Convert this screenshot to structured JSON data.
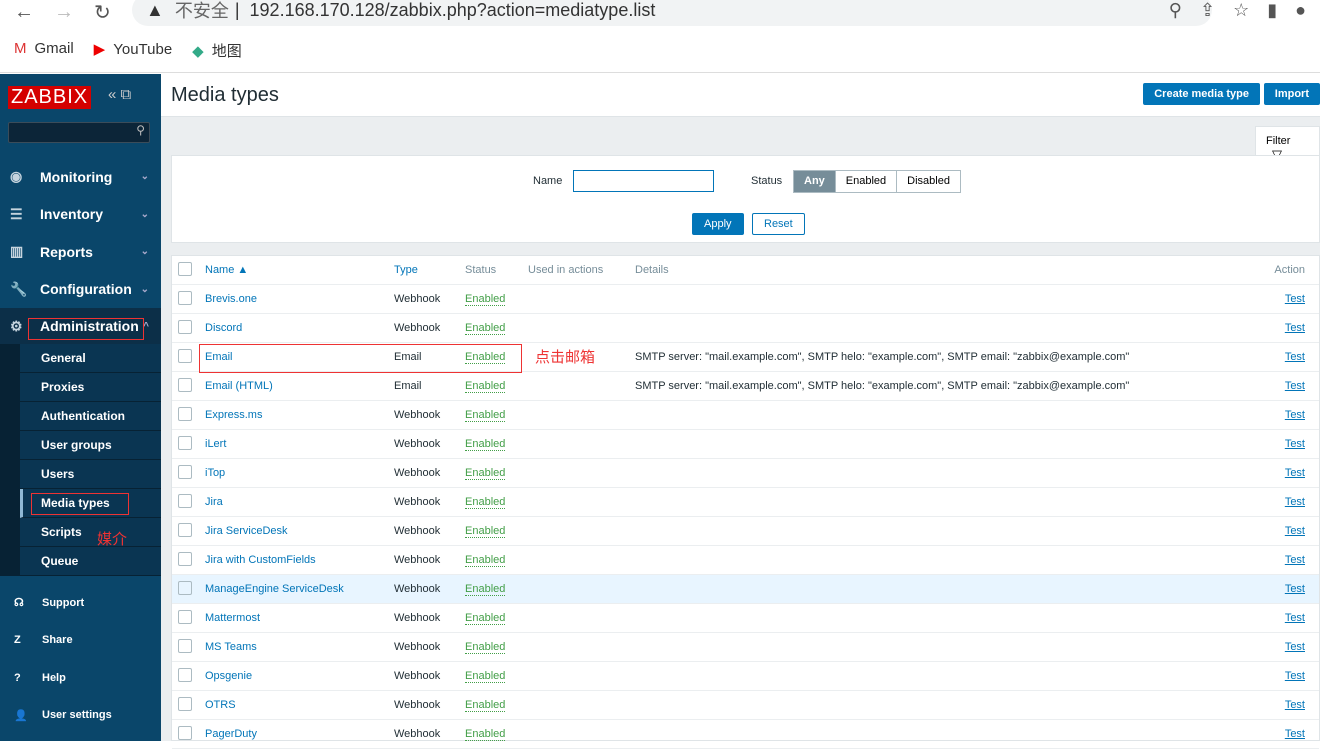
{
  "browser": {
    "insecure": "不安全",
    "url": "192.168.170.128/zabbix.php?action=mediatype.list",
    "bookmarks": [
      "Gmail",
      "YouTube",
      "地图"
    ]
  },
  "sidebar": {
    "logo": "ZABBIX",
    "menu": [
      {
        "label": "Monitoring",
        "icon": "eye-icon"
      },
      {
        "label": "Inventory",
        "icon": "list-icon"
      },
      {
        "label": "Reports",
        "icon": "chart-icon"
      },
      {
        "label": "Configuration",
        "icon": "wrench-icon"
      }
    ],
    "admin": "Administration",
    "sub": [
      "General",
      "Proxies",
      "Authentication",
      "User groups",
      "Users",
      "Media types",
      "Scripts",
      "Queue"
    ],
    "bottom": [
      {
        "label": "Support",
        "icon": "headset-icon"
      },
      {
        "label": "Share",
        "icon": "share-icon"
      },
      {
        "label": "Help",
        "icon": "help-icon"
      },
      {
        "label": "User settings",
        "icon": "user-icon"
      }
    ]
  },
  "header": {
    "title": "Media types",
    "create": "Create media type",
    "import": "Import"
  },
  "filter": {
    "tab": "Filter",
    "name_label": "Name",
    "name_value": "",
    "status_label": "Status",
    "status_options": [
      "Any",
      "Enabled",
      "Disabled"
    ],
    "selected": "Any",
    "apply": "Apply",
    "reset": "Reset"
  },
  "table": {
    "headers": {
      "name": "Name ▲",
      "type": "Type",
      "status": "Status",
      "used": "Used in actions",
      "details": "Details",
      "action": "Action"
    },
    "rows": [
      {
        "name": "Brevis.one",
        "type": "Webhook",
        "status": "Enabled",
        "details": "",
        "action": "Test"
      },
      {
        "name": "Discord",
        "type": "Webhook",
        "status": "Enabled",
        "details": "",
        "action": "Test"
      },
      {
        "name": "Email",
        "type": "Email",
        "status": "Enabled",
        "details": "SMTP server: \"mail.example.com\", SMTP helo: \"example.com\", SMTP email: \"zabbix@example.com\"",
        "action": "Test"
      },
      {
        "name": "Email (HTML)",
        "type": "Email",
        "status": "Enabled",
        "details": "SMTP server: \"mail.example.com\", SMTP helo: \"example.com\", SMTP email: \"zabbix@example.com\"",
        "action": "Test"
      },
      {
        "name": "Express.ms",
        "type": "Webhook",
        "status": "Enabled",
        "details": "",
        "action": "Test"
      },
      {
        "name": "iLert",
        "type": "Webhook",
        "status": "Enabled",
        "details": "",
        "action": "Test"
      },
      {
        "name": "iTop",
        "type": "Webhook",
        "status": "Enabled",
        "details": "",
        "action": "Test"
      },
      {
        "name": "Jira",
        "type": "Webhook",
        "status": "Enabled",
        "details": "",
        "action": "Test"
      },
      {
        "name": "Jira ServiceDesk",
        "type": "Webhook",
        "status": "Enabled",
        "details": "",
        "action": "Test"
      },
      {
        "name": "Jira with CustomFields",
        "type": "Webhook",
        "status": "Enabled",
        "details": "",
        "action": "Test"
      },
      {
        "name": "ManageEngine ServiceDesk",
        "type": "Webhook",
        "status": "Enabled",
        "details": "",
        "action": "Test"
      },
      {
        "name": "Mattermost",
        "type": "Webhook",
        "status": "Enabled",
        "details": "",
        "action": "Test"
      },
      {
        "name": "MS Teams",
        "type": "Webhook",
        "status": "Enabled",
        "details": "",
        "action": "Test"
      },
      {
        "name": "Opsgenie",
        "type": "Webhook",
        "status": "Enabled",
        "details": "",
        "action": "Test"
      },
      {
        "name": "OTRS",
        "type": "Webhook",
        "status": "Enabled",
        "details": "",
        "action": "Test"
      },
      {
        "name": "PagerDuty",
        "type": "Webhook",
        "status": "Enabled",
        "details": "",
        "action": "Test"
      }
    ]
  },
  "annotations": {
    "email": "点击邮箱",
    "media": "媒介"
  }
}
